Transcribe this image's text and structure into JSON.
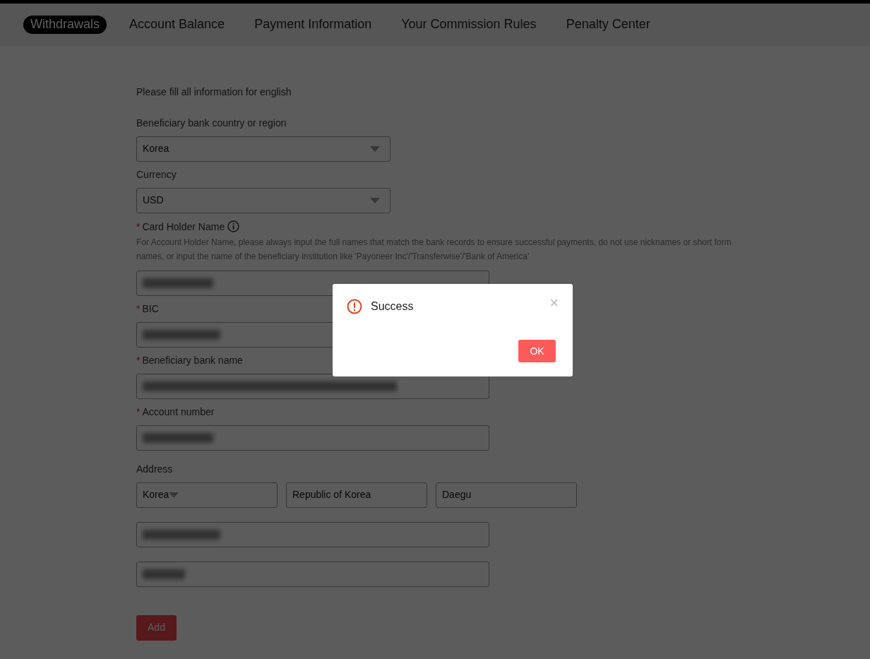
{
  "tabs": [
    {
      "label": "Withdrawals",
      "selected": true
    },
    {
      "label": "Account Balance",
      "selected": false
    },
    {
      "label": "Payment Information",
      "selected": false
    },
    {
      "label": "Your Commission Rules",
      "selected": false
    },
    {
      "label": "Penalty Center",
      "selected": false
    }
  ],
  "form": {
    "intro": "Please fill all information for english",
    "fields": [
      {
        "kind": "select",
        "label": "Beneficiary bank country or region",
        "value": "Korea"
      },
      {
        "kind": "select",
        "label": "Currency",
        "value": "USD"
      },
      {
        "kind": "text",
        "label": "Card Holder Name",
        "required_mark": "*",
        "info": true,
        "hint": "For Account Holder Name, please always input the full names that match the bank records to ensure successful payments, do not use nicknames or short form names, or input the name of the beneficiary institution like 'Payoneer Inc'/'Transferwise'/'Bank of America'",
        "redacted": true
      },
      {
        "kind": "text",
        "label": "BIC",
        "required_mark": "*",
        "redacted": true
      },
      {
        "kind": "text",
        "label": "Beneficiary bank name",
        "required_mark": "*",
        "redacted": true
      },
      {
        "kind": "text",
        "label": "Account number",
        "required_mark": "*",
        "redacted": true
      }
    ],
    "address": {
      "label": "Address",
      "row": [
        {
          "kind": "select",
          "value": "Korea"
        },
        {
          "kind": "text",
          "value": "Republic of Korea"
        },
        {
          "kind": "text",
          "value": "Daegu"
        }
      ],
      "lines": [
        {
          "kind": "text",
          "redacted": true
        },
        {
          "kind": "text",
          "redacted": true
        }
      ]
    },
    "submit": "Add"
  },
  "dialog": {
    "title": "Success",
    "close": "×",
    "button": "OK"
  }
}
